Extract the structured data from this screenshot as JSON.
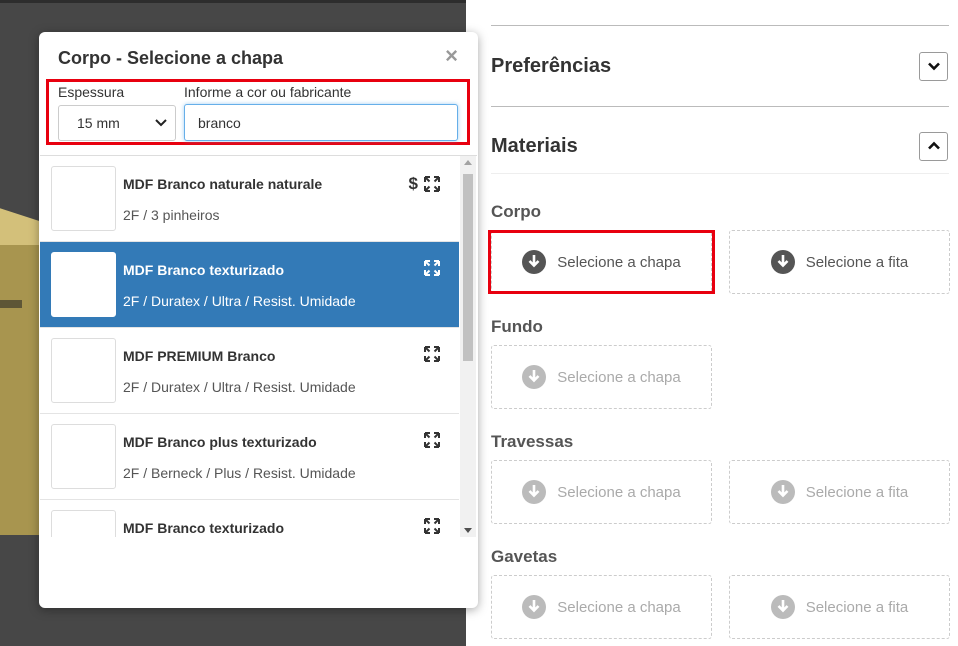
{
  "modal": {
    "title": "Corpo - Selecione a chapa",
    "close_symbol": "×",
    "thickness_label": "Espessura",
    "thickness_value": "15 mm",
    "search_label": "Informe a cor ou fabricante",
    "search_value": "branco",
    "items": [
      {
        "name": "MDF Branco naturale naturale",
        "meta": "2F / 3 pinheiros",
        "price_symbol": "$",
        "selected": false
      },
      {
        "name": "MDF Branco texturizado",
        "meta": "2F / Duratex / Ultra / Resist. Umidade",
        "price_symbol": "",
        "selected": true
      },
      {
        "name": "MDF PREMIUM Branco",
        "meta": "2F / Duratex / Ultra / Resist. Umidade",
        "price_symbol": "",
        "selected": false
      },
      {
        "name": "MDF Branco plus texturizado",
        "meta": "2F / Berneck / Plus / Resist. Umidade",
        "price_symbol": "",
        "selected": false
      },
      {
        "name": "MDF Branco texturizado",
        "meta": "",
        "price_symbol": "",
        "selected": false
      }
    ]
  },
  "panel": {
    "preferences_title": "Preferências",
    "materials_title": "Materiais",
    "groups": [
      {
        "label": "Corpo",
        "chapa": "Selecione a chapa",
        "fita": "Selecione a fita"
      },
      {
        "label": "Fundo",
        "chapa": "Selecione a chapa"
      },
      {
        "label": "Travessas",
        "chapa": "Selecione a chapa",
        "fita": "Selecione a fita"
      },
      {
        "label": "Gavetas",
        "chapa": "Selecione a chapa",
        "fita": "Selecione a fita"
      }
    ]
  },
  "icons": {
    "expand": "expand-icon",
    "download": "arrow-down-circle-icon",
    "chevron_down": "chevron-down-icon",
    "chevron_up": "chevron-up-icon"
  },
  "colors": {
    "highlight_outline": "#e8000f",
    "selected_item_bg": "#337ab7"
  }
}
